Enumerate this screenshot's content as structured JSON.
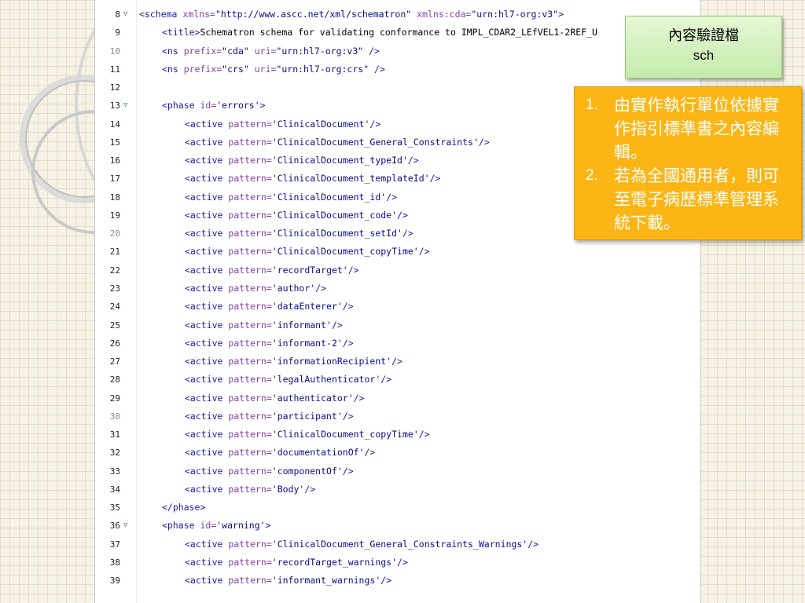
{
  "callouts": {
    "file_label": {
      "line1": "內容驗證檔",
      "line2": "sch"
    },
    "notes": [
      {
        "num": "1.",
        "text": "由實作執行單位依據實作指引標準書之內容編輯。"
      },
      {
        "num": "2.",
        "text": "若為全國通用者，則可至電子病歷標準管理系統下載。"
      }
    ]
  },
  "editor": {
    "lines": [
      {
        "n": "8",
        "fold": "▽",
        "indent": 0,
        "parts": [
          [
            "tag",
            "<schema "
          ],
          [
            "attr",
            "xmlns="
          ],
          [
            "val",
            "\"http://www.ascc.net/xml/schematron\" "
          ],
          [
            "attr",
            "xmlns:cda="
          ],
          [
            "val",
            "\"urn:hl7-org:v3\""
          ],
          [
            "tag",
            ">"
          ]
        ]
      },
      {
        "n": "9",
        "indent": 1,
        "parts": [
          [
            "tag",
            "<title>"
          ],
          [
            "txt",
            "Schematron schema for validating conformance to IMPL_CDAR2_LEfVEL1-2REF_U"
          ]
        ]
      },
      {
        "n": "10",
        "dim": true,
        "indent": 1,
        "parts": [
          [
            "tag",
            "<ns "
          ],
          [
            "attr",
            "prefix="
          ],
          [
            "val",
            "\"cda\" "
          ],
          [
            "attr",
            "uri="
          ],
          [
            "val",
            "\"urn:hl7-org:v3\" "
          ],
          [
            "tag",
            "/>"
          ]
        ]
      },
      {
        "n": "11",
        "indent": 1,
        "parts": [
          [
            "tag",
            "<ns "
          ],
          [
            "attr",
            "prefix="
          ],
          [
            "val",
            "\"crs\" "
          ],
          [
            "attr",
            "uri="
          ],
          [
            "val",
            "\"urn:hl7-org:crs\" "
          ],
          [
            "tag",
            "/>"
          ]
        ]
      },
      {
        "n": "12",
        "indent": 0,
        "parts": []
      },
      {
        "n": "13",
        "fold": "▽",
        "indent": 1,
        "parts": [
          [
            "tag",
            "<phase "
          ],
          [
            "attr",
            "id="
          ],
          [
            "val",
            "'errors'"
          ],
          [
            "tag",
            ">"
          ]
        ]
      },
      {
        "n": "14",
        "indent": 2,
        "parts": [
          [
            "tag",
            "<active "
          ],
          [
            "attr",
            "pattern="
          ],
          [
            "val",
            "'ClinicalDocument'"
          ],
          [
            "tag",
            "/>"
          ]
        ]
      },
      {
        "n": "15",
        "indent": 2,
        "parts": [
          [
            "tag",
            "<active "
          ],
          [
            "attr",
            "pattern="
          ],
          [
            "val",
            "'ClinicalDocument_General_Constraints'"
          ],
          [
            "tag",
            "/>"
          ]
        ]
      },
      {
        "n": "16",
        "indent": 2,
        "parts": [
          [
            "tag",
            "<active "
          ],
          [
            "attr",
            "pattern="
          ],
          [
            "val",
            "'ClinicalDocument_typeId'"
          ],
          [
            "tag",
            "/>"
          ]
        ]
      },
      {
        "n": "17",
        "indent": 2,
        "parts": [
          [
            "tag",
            "<active "
          ],
          [
            "attr",
            "pattern="
          ],
          [
            "val",
            "'ClinicalDocument_templateId'"
          ],
          [
            "tag",
            "/>"
          ]
        ]
      },
      {
        "n": "18",
        "indent": 2,
        "parts": [
          [
            "tag",
            "<active "
          ],
          [
            "attr",
            "pattern="
          ],
          [
            "val",
            "'ClinicalDocument_id'"
          ],
          [
            "tag",
            "/>"
          ]
        ]
      },
      {
        "n": "19",
        "indent": 2,
        "parts": [
          [
            "tag",
            "<active "
          ],
          [
            "attr",
            "pattern="
          ],
          [
            "val",
            "'ClinicalDocument_code'"
          ],
          [
            "tag",
            "/>"
          ]
        ]
      },
      {
        "n": "20",
        "dim": true,
        "indent": 2,
        "parts": [
          [
            "tag",
            "<active "
          ],
          [
            "attr",
            "pattern="
          ],
          [
            "val",
            "'ClinicalDocument_setId'"
          ],
          [
            "tag",
            "/>"
          ]
        ]
      },
      {
        "n": "21",
        "indent": 2,
        "parts": [
          [
            "tag",
            "<active "
          ],
          [
            "attr",
            "pattern="
          ],
          [
            "val",
            "'ClinicalDocument_copyTime'"
          ],
          [
            "tag",
            "/>"
          ]
        ]
      },
      {
        "n": "22",
        "indent": 2,
        "parts": [
          [
            "tag",
            "<active "
          ],
          [
            "attr",
            "pattern="
          ],
          [
            "val",
            "'recordTarget'"
          ],
          [
            "tag",
            "/>"
          ]
        ]
      },
      {
        "n": "23",
        "indent": 2,
        "parts": [
          [
            "tag",
            "<active "
          ],
          [
            "attr",
            "pattern="
          ],
          [
            "val",
            "'author'"
          ],
          [
            "tag",
            "/>"
          ]
        ]
      },
      {
        "n": "24",
        "indent": 2,
        "parts": [
          [
            "tag",
            "<active "
          ],
          [
            "attr",
            "pattern="
          ],
          [
            "val",
            "'dataEnterer'"
          ],
          [
            "tag",
            "/>"
          ]
        ]
      },
      {
        "n": "25",
        "indent": 2,
        "parts": [
          [
            "tag",
            "<active "
          ],
          [
            "attr",
            "pattern="
          ],
          [
            "val",
            "'informant'"
          ],
          [
            "tag",
            "/>"
          ]
        ]
      },
      {
        "n": "26",
        "indent": 2,
        "parts": [
          [
            "tag",
            "<active "
          ],
          [
            "attr",
            "pattern="
          ],
          [
            "val",
            "'informant-2'"
          ],
          [
            "tag",
            "/>"
          ]
        ]
      },
      {
        "n": "27",
        "indent": 2,
        "parts": [
          [
            "tag",
            "<active "
          ],
          [
            "attr",
            "pattern="
          ],
          [
            "val",
            "'informationRecipient'"
          ],
          [
            "tag",
            "/>"
          ]
        ]
      },
      {
        "n": "28",
        "indent": 2,
        "parts": [
          [
            "tag",
            "<active "
          ],
          [
            "attr",
            "pattern="
          ],
          [
            "val",
            "'legalAuthenticator'"
          ],
          [
            "tag",
            "/>"
          ]
        ]
      },
      {
        "n": "29",
        "indent": 2,
        "parts": [
          [
            "tag",
            "<active "
          ],
          [
            "attr",
            "pattern="
          ],
          [
            "val",
            "'authenticator'"
          ],
          [
            "tag",
            "/>"
          ]
        ]
      },
      {
        "n": "30",
        "dim": true,
        "indent": 2,
        "parts": [
          [
            "tag",
            "<active "
          ],
          [
            "attr",
            "pattern="
          ],
          [
            "val",
            "'participant'"
          ],
          [
            "tag",
            "/>"
          ]
        ]
      },
      {
        "n": "31",
        "indent": 2,
        "parts": [
          [
            "tag",
            "<active "
          ],
          [
            "attr",
            "pattern="
          ],
          [
            "val",
            "'ClinicalDocument_copyTime'"
          ],
          [
            "tag",
            "/>"
          ]
        ]
      },
      {
        "n": "32",
        "indent": 2,
        "parts": [
          [
            "tag",
            "<active "
          ],
          [
            "attr",
            "pattern="
          ],
          [
            "val",
            "'documentationOf'"
          ],
          [
            "tag",
            "/>"
          ]
        ]
      },
      {
        "n": "33",
        "indent": 2,
        "parts": [
          [
            "tag",
            "<active "
          ],
          [
            "attr",
            "pattern="
          ],
          [
            "val",
            "'componentOf'"
          ],
          [
            "tag",
            "/>"
          ]
        ]
      },
      {
        "n": "34",
        "indent": 2,
        "parts": [
          [
            "tag",
            "<active "
          ],
          [
            "attr",
            "pattern="
          ],
          [
            "val",
            "'Body'"
          ],
          [
            "tag",
            "/>"
          ]
        ]
      },
      {
        "n": "35",
        "indent": 1,
        "parts": [
          [
            "tag",
            "</phase>"
          ]
        ]
      },
      {
        "n": "36",
        "fold": "▽",
        "indent": 1,
        "parts": [
          [
            "tag",
            "<phase "
          ],
          [
            "attr",
            "id="
          ],
          [
            "val",
            "'warning'"
          ],
          [
            "tag",
            ">"
          ]
        ]
      },
      {
        "n": "37",
        "indent": 2,
        "parts": [
          [
            "tag",
            "<active "
          ],
          [
            "attr",
            "pattern="
          ],
          [
            "val",
            "'ClinicalDocument_General_Constraints_Warnings'"
          ],
          [
            "tag",
            "/>"
          ]
        ]
      },
      {
        "n": "38",
        "indent": 2,
        "parts": [
          [
            "tag",
            "<active "
          ],
          [
            "attr",
            "pattern="
          ],
          [
            "val",
            "'recordTarget_warnings'"
          ],
          [
            "tag",
            "/>"
          ]
        ]
      },
      {
        "n": "39",
        "indent": 2,
        "parts": [
          [
            "tag",
            "<active "
          ],
          [
            "attr",
            "pattern="
          ],
          [
            "val",
            "'informant_warnings'"
          ],
          [
            "tag",
            "/>"
          ]
        ]
      }
    ]
  }
}
